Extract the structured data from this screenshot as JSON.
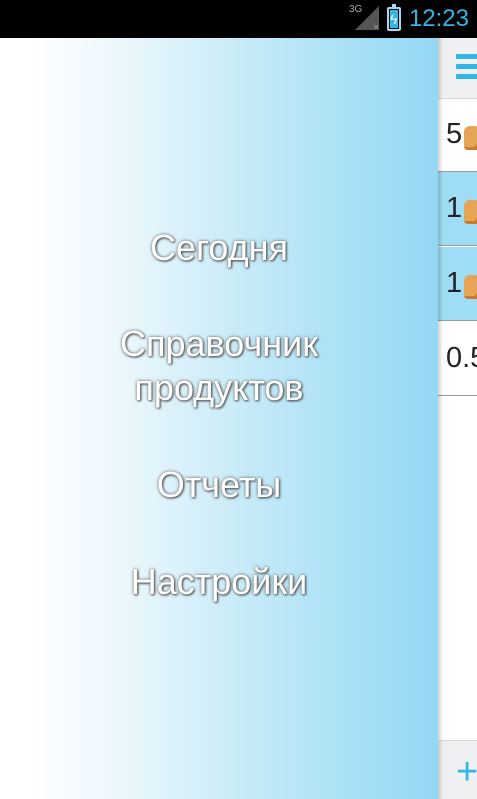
{
  "status_bar": {
    "network": "3G",
    "time": "12:23",
    "accent_color": "#33b5e5",
    "icons": [
      "signal-3g-icon",
      "battery-charging-icon"
    ]
  },
  "drawer": {
    "items": [
      {
        "label": "Сегодня"
      },
      {
        "label": "Справочник продуктов"
      },
      {
        "label": "Отчеты"
      },
      {
        "label": "Настройки"
      }
    ]
  },
  "content": {
    "rows": [
      {
        "qty": "5",
        "highlighted": false
      },
      {
        "qty": "1",
        "highlighted": true
      },
      {
        "qty": "1",
        "highlighted": true
      },
      {
        "qty": "0.5",
        "highlighted": false
      }
    ],
    "highlight_color": "#9fdcf5",
    "icons": [
      "menu-icon",
      "add-icon",
      "food-icon"
    ]
  }
}
